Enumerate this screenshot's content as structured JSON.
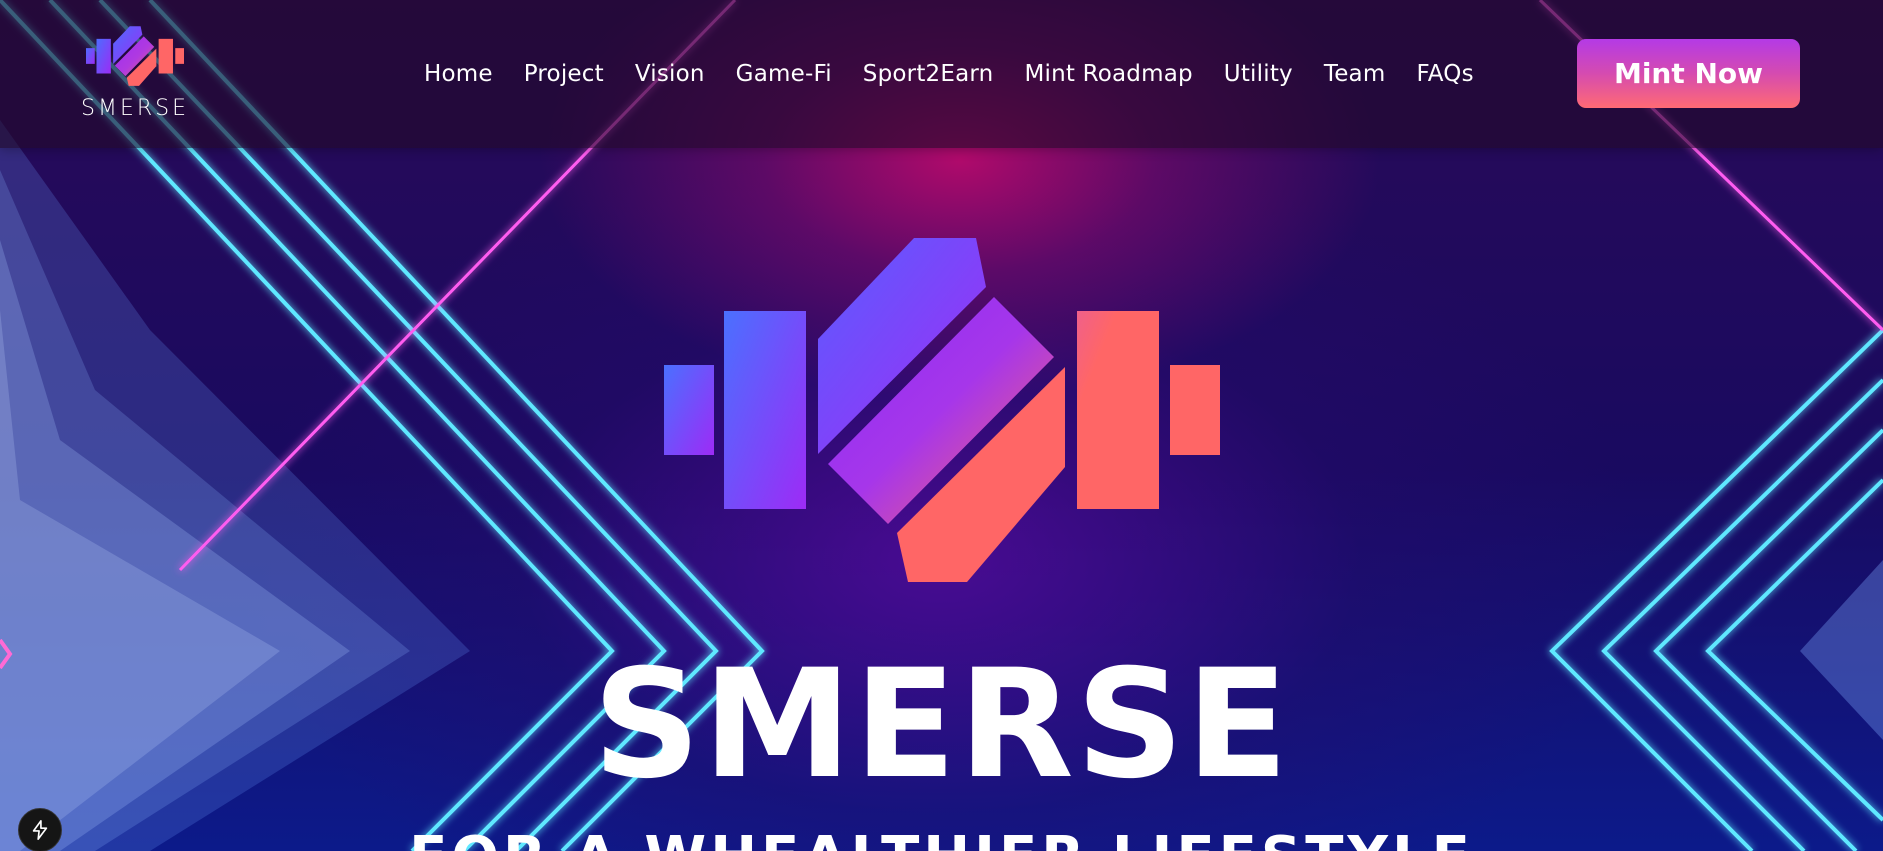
{
  "brand": {
    "name": "SMERSE",
    "colors": {
      "blue": "#4d6cff",
      "purple": "#9b2cf5",
      "coral": "#ff6666",
      "neon_cyan": "#3fe3ff",
      "neon_magenta": "#ff4df2"
    }
  },
  "nav": {
    "items": [
      {
        "label": "Home"
      },
      {
        "label": "Project"
      },
      {
        "label": "Vision"
      },
      {
        "label": "Game-Fi"
      },
      {
        "label": "Sport2Earn"
      },
      {
        "label": "Mint Roadmap"
      },
      {
        "label": "Utility"
      },
      {
        "label": "Team"
      },
      {
        "label": "FAQs"
      }
    ]
  },
  "header": {
    "mint_label": "Mint Now"
  },
  "hero": {
    "title": "SMERSE",
    "tagline": "FOR A WHEALTHIER LIFESTYLE"
  },
  "widgets": {
    "corner_icon": "lightning-bolt-icon"
  }
}
